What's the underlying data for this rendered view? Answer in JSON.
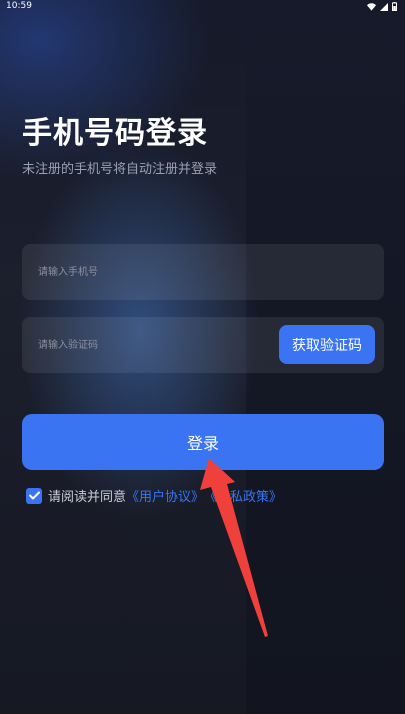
{
  "status_bar": {
    "time": "10:59"
  },
  "login": {
    "title": "手机号码登录",
    "subtitle": "未注册的手机号将自动注册并登录",
    "phone_placeholder": "请输入手机号",
    "code_placeholder": "请输入验证码",
    "get_code_label": "获取验证码",
    "login_label": "登录"
  },
  "agreement": {
    "checked": true,
    "prefix": "请阅读并同意",
    "user_agreement": "《用户协议》",
    "privacy_policy": "《隐私政策》"
  },
  "colors": {
    "background": "#141726",
    "accent": "#3a74f2",
    "annotation_arrow": "#f0403c"
  }
}
